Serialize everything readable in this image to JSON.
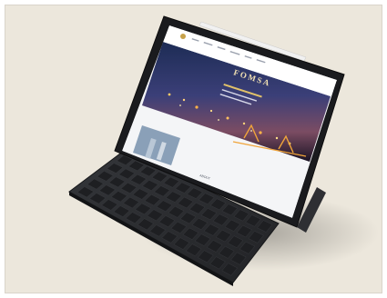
{
  "scene": {
    "subject": "tablet-with-keyboard-case",
    "background_color": "#ece7dc",
    "device_color": "#1a1b1e",
    "keyboard_color": "#2a2b2e"
  },
  "screen": {
    "logo_text": "FOMSA",
    "about_label": "ABOUT"
  }
}
